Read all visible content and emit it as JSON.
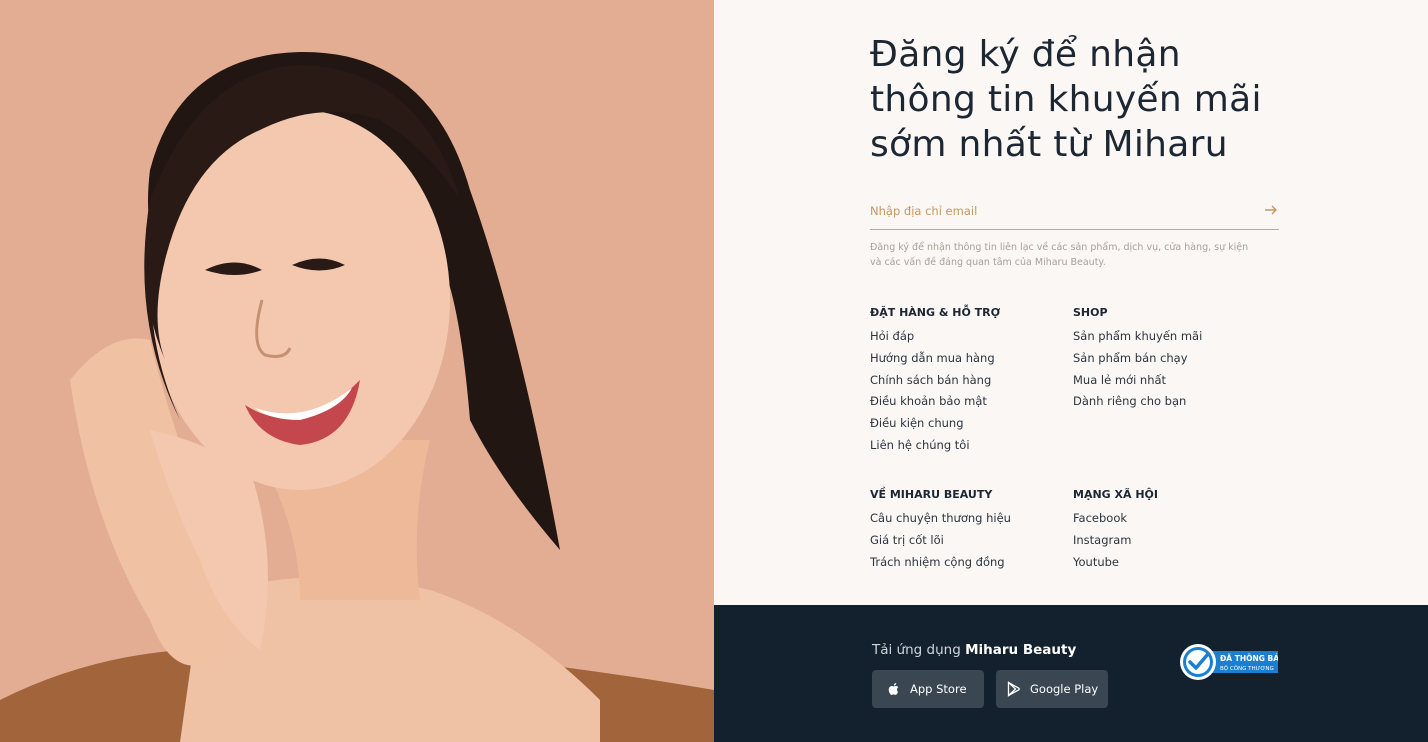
{
  "hero": {
    "image_desc": "smiling-woman-portrait"
  },
  "newsletter": {
    "headline_lines": [
      "Đăng ký để nhận",
      "thông tin khuyến mãi",
      "sớm nhất từ Miharu"
    ],
    "email_placeholder": "Nhập địa chỉ email",
    "consent_line1": "Đăng ký để nhận thông tin liên lạc về các sản phẩm, dịch vụ, cửa hàng, sự kiện",
    "consent_line2": "và các vấn đề đáng quan tâm của Miharu Beauty."
  },
  "columns": [
    {
      "heading": "ĐẶT HÀNG & HỖ TRỢ",
      "links": [
        "Hỏi đáp",
        "Hướng dẫn mua hàng",
        "Chính sách bán hàng",
        "Điều khoản bảo mật",
        "Điều kiện chung",
        "Liên hệ chúng tôi"
      ]
    },
    {
      "heading": "SHOP",
      "links": [
        "Sản phẩm khuyến mãi",
        "Sản phẩm bán chạy",
        "Mua lẻ mới nhất",
        "Dành riêng cho bạn"
      ]
    },
    {
      "heading": "VỀ MIHARU BEAUTY",
      "links": [
        "Câu chuyện thương hiệu",
        "Giá trị cốt lõi",
        "Trách nhiệm cộng đồng"
      ]
    },
    {
      "heading": "MẠNG XÃ HỘI",
      "links": [
        "Facebook",
        "Instagram",
        "Youtube"
      ]
    }
  ],
  "footer": {
    "app_prefix": "Tải ứng dụng ",
    "app_name": "Miharu Beauty",
    "app_store_label": "App Store",
    "google_play_label": "Google Play",
    "badge_line1": "ĐÃ THÔNG BÁO",
    "badge_line2": "BỘ CÔNG THƯƠNG"
  },
  "colors": {
    "hero_bg": "#e2ad93",
    "accent": "#c8965f",
    "footer_bg": "#13212e",
    "page_bg": "#fbf7f4",
    "badge_blue": "#1b7fd1"
  }
}
